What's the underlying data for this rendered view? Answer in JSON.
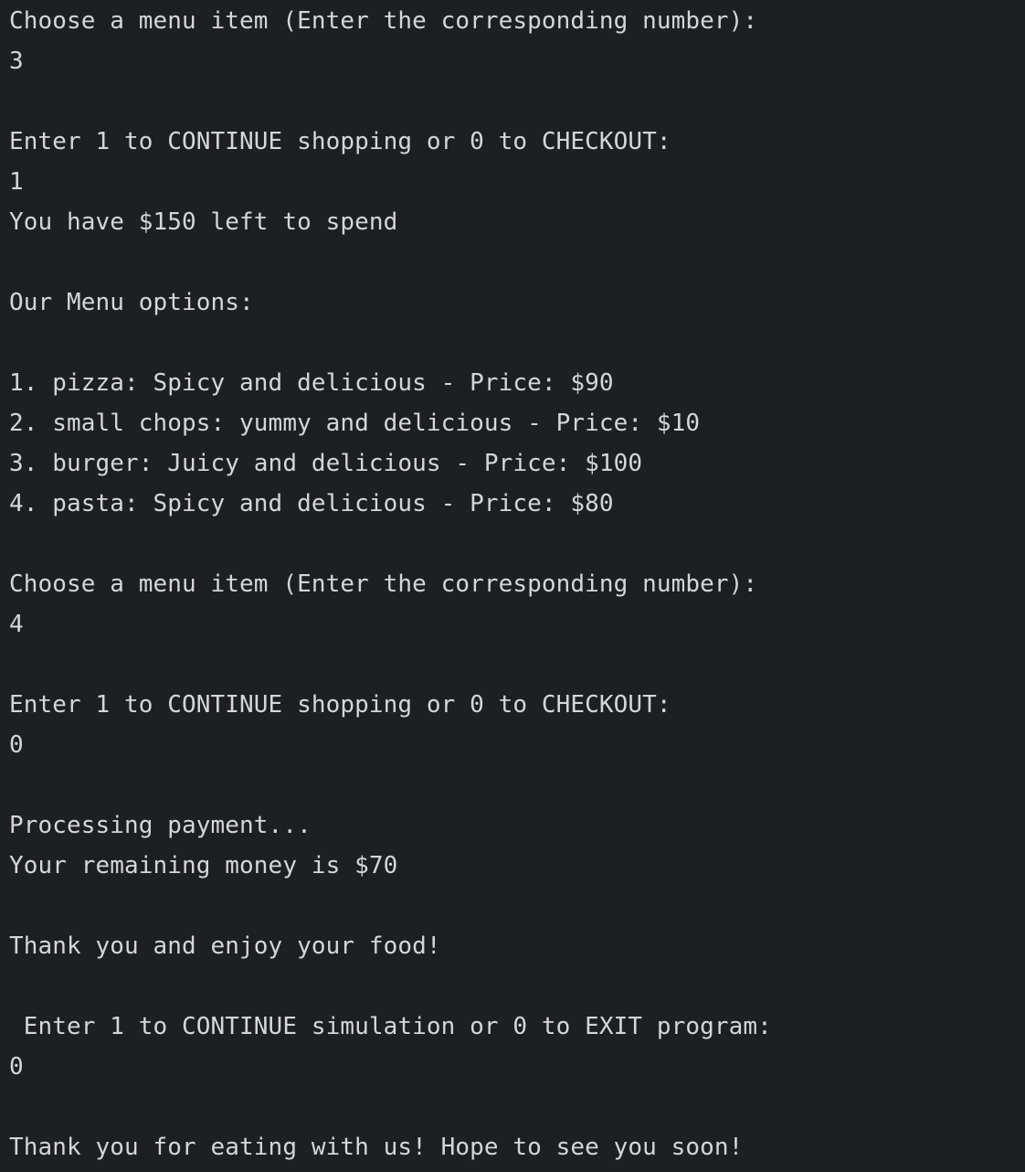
{
  "console": {
    "lines": [
      "Choose a menu item (Enter the corresponding number):",
      "3",
      "",
      "Enter 1 to CONTINUE shopping or 0 to CHECKOUT:",
      "1",
      "You have $150 left to spend",
      "",
      "Our Menu options:",
      "",
      "1. pizza: Spicy and delicious - Price: $90",
      "2. small chops: yummy and delicious - Price: $10",
      "3. burger: Juicy and delicious - Price: $100",
      "4. pasta: Spicy and delicious - Price: $80",
      "",
      "Choose a menu item (Enter the corresponding number):",
      "4",
      "",
      "Enter 1 to CONTINUE shopping or 0 to CHECKOUT:",
      "0",
      "",
      "Processing payment...",
      "Your remaining money is $70",
      "",
      "Thank you and enjoy your food!",
      "",
      " Enter 1 to CONTINUE simulation or 0 to EXIT program:",
      "0",
      "",
      "Thank you for eating with us! Hope to see you soon!"
    ]
  }
}
